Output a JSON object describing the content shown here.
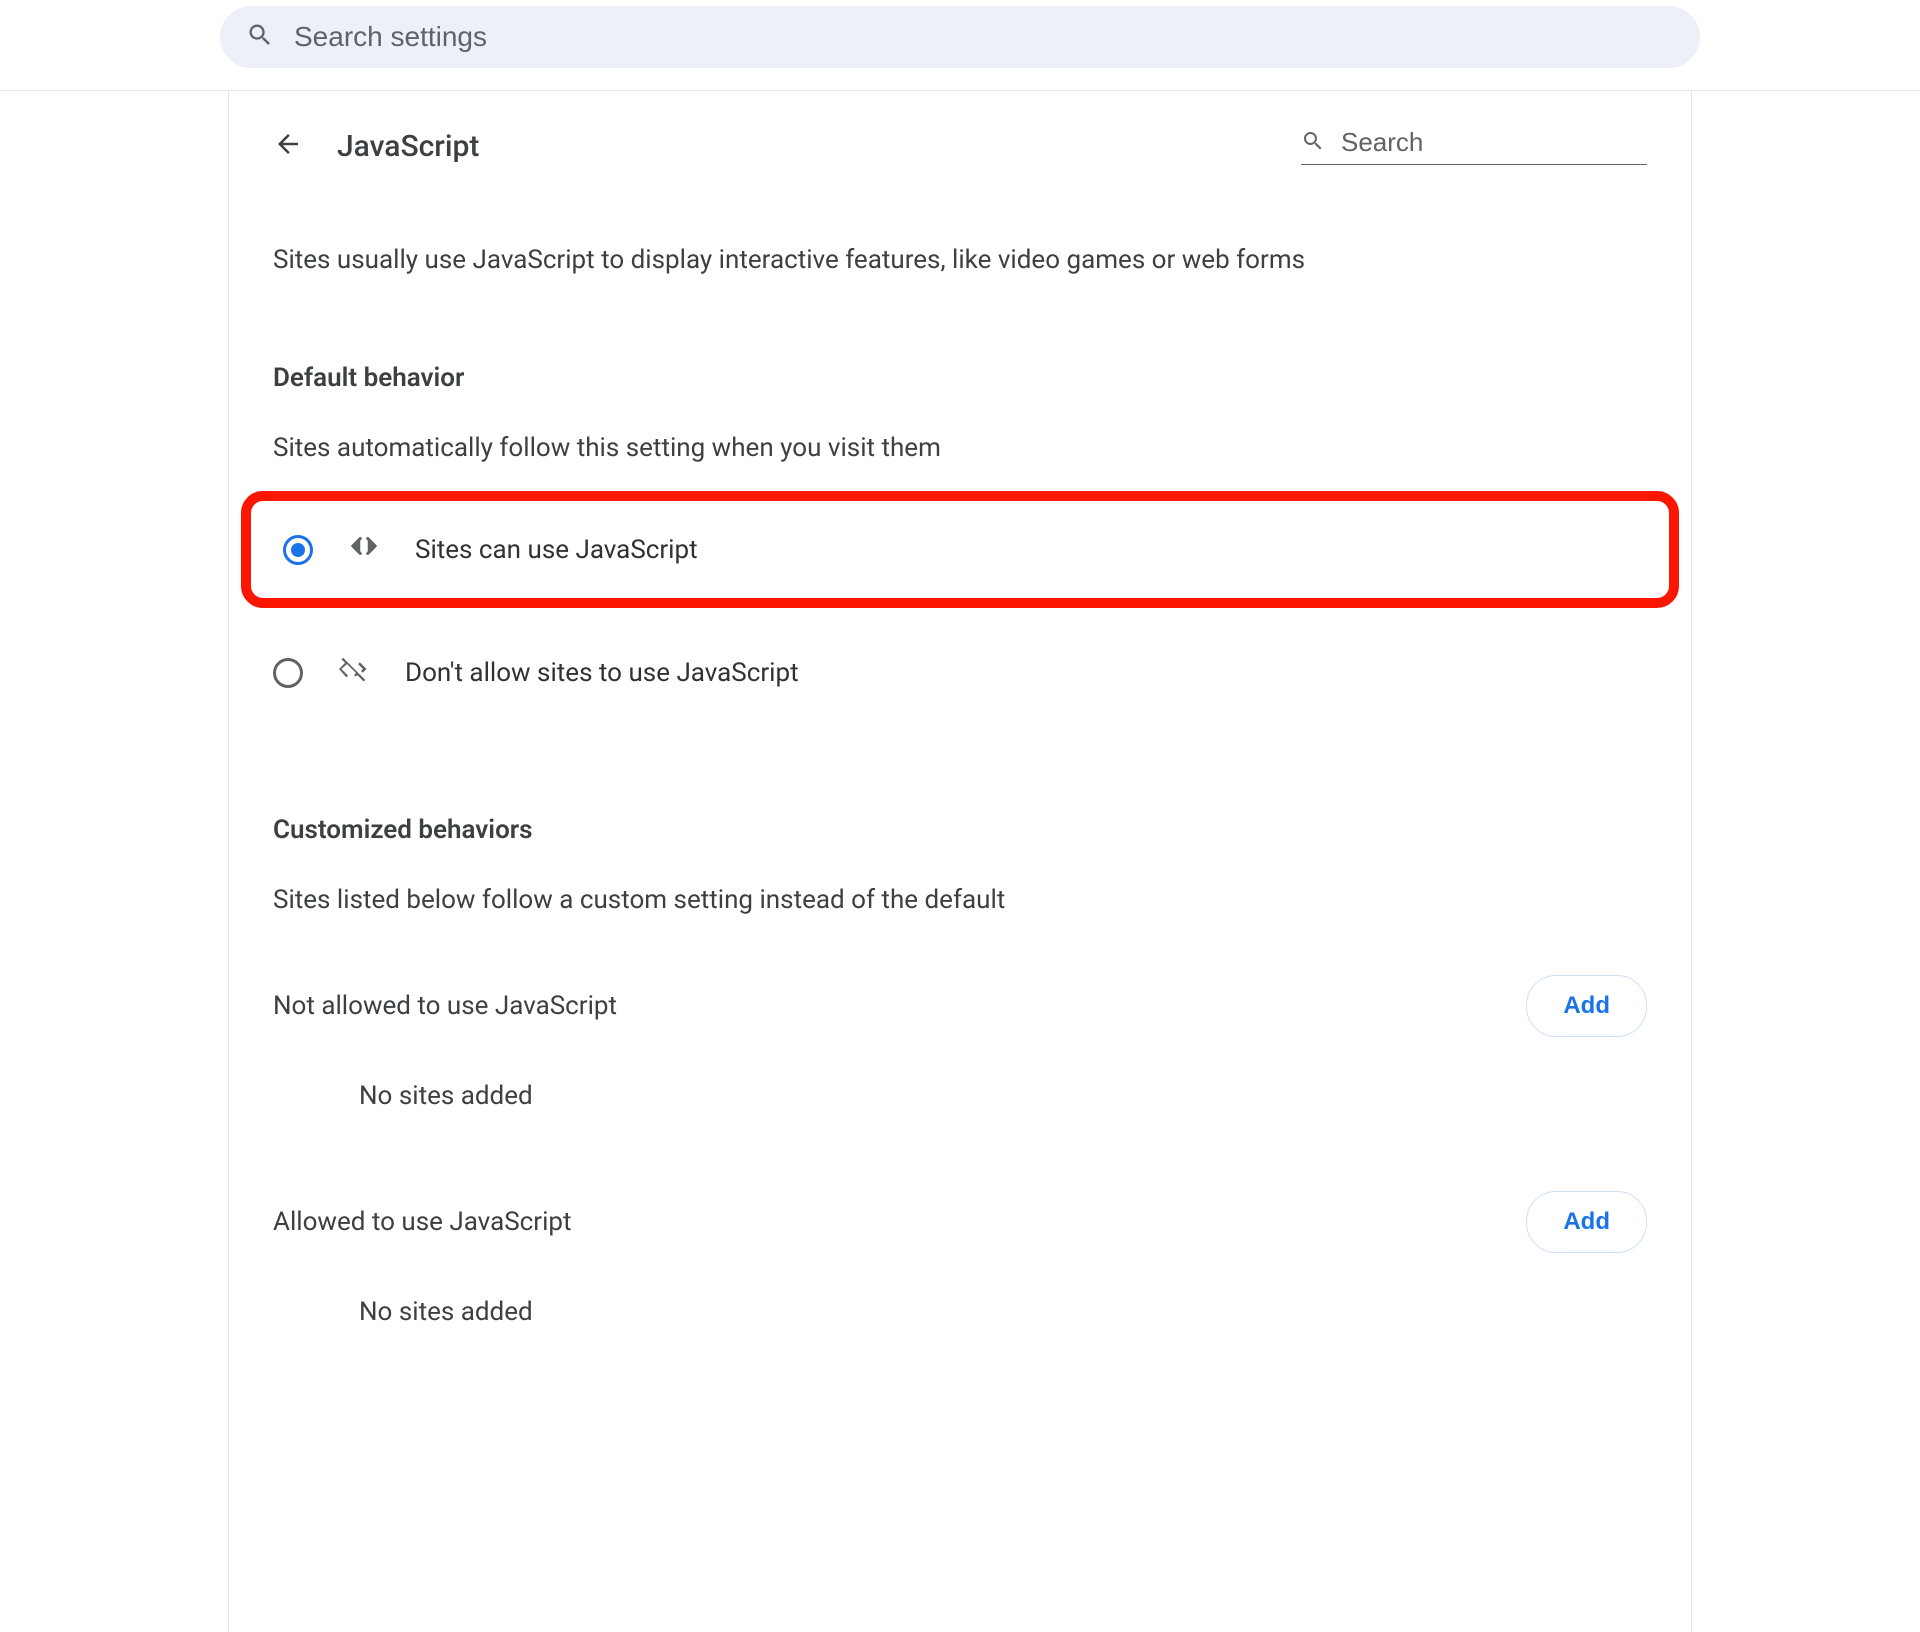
{
  "topSearch": {
    "placeholder": "Search settings"
  },
  "page": {
    "title": "JavaScript",
    "inlineSearchPlaceholder": "Search",
    "intro": "Sites usually use JavaScript to display interactive features, like video games or web forms"
  },
  "defaultBehavior": {
    "heading": "Default behavior",
    "sub": "Sites automatically follow this setting when you visit them",
    "options": {
      "allow": {
        "label": "Sites can use JavaScript",
        "selected": true
      },
      "block": {
        "label": "Don't allow sites to use JavaScript",
        "selected": false
      }
    }
  },
  "customized": {
    "heading": "Customized behaviors",
    "sub": "Sites listed below follow a custom setting instead of the default",
    "blockList": {
      "label": "Not allowed to use JavaScript",
      "empty": "No sites added",
      "addLabel": "Add"
    },
    "allowList": {
      "label": "Allowed to use JavaScript",
      "empty": "No sites added",
      "addLabel": "Add"
    }
  },
  "colors": {
    "accent": "#1a73e8",
    "highlight": "#fb1600"
  }
}
